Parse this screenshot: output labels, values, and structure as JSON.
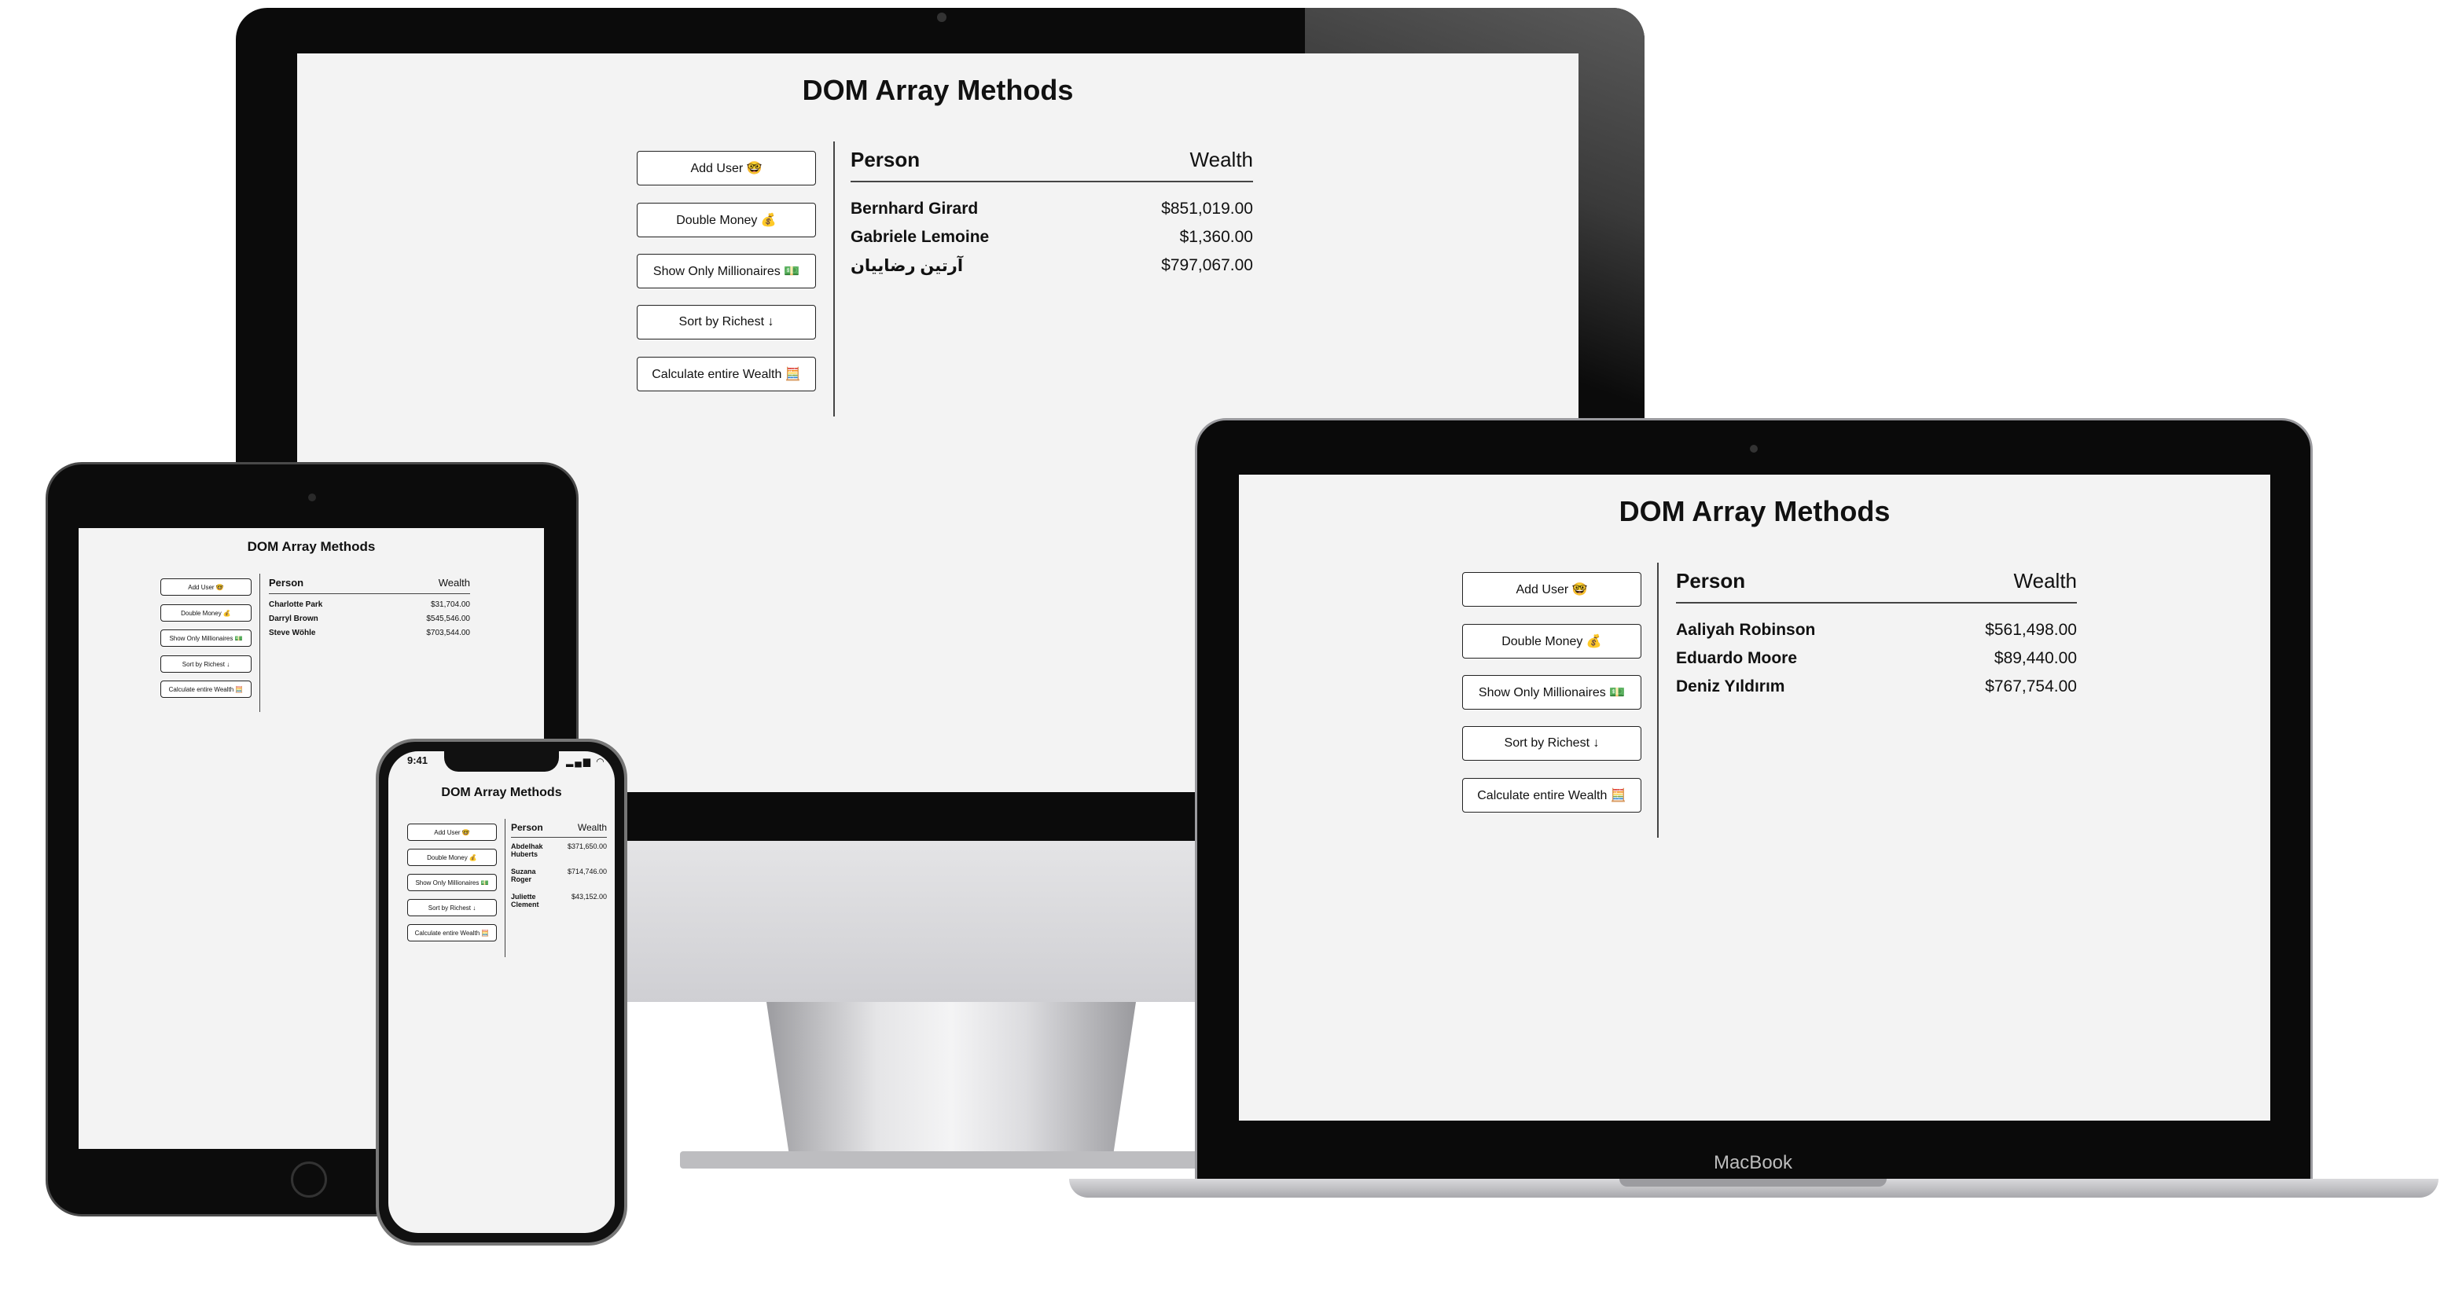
{
  "app": {
    "title": "DOM Array Methods",
    "buttons": {
      "add_user": "Add User 🤓",
      "double_money": "Double Money 💰",
      "show_millionaires": "Show Only Millionaires 💵",
      "sort_richest": "Sort by Richest ↓",
      "calculate_wealth": "Calculate entire Wealth 🧮"
    },
    "columns": {
      "person": "Person",
      "wealth": "Wealth"
    }
  },
  "devices": {
    "imac": {
      "rows": [
        {
          "person": "Bernhard Girard",
          "wealth": "$851,019.00"
        },
        {
          "person": "Gabriele Lemoine",
          "wealth": "$1,360.00"
        },
        {
          "person": "آرتین رضاییان",
          "wealth": "$797,067.00"
        }
      ]
    },
    "macbook": {
      "label": "MacBook",
      "rows": [
        {
          "person": "Aaliyah Robinson",
          "wealth": "$561,498.00"
        },
        {
          "person": "Eduardo Moore",
          "wealth": "$89,440.00"
        },
        {
          "person": "Deniz Yıldırım",
          "wealth": "$767,754.00"
        }
      ]
    },
    "ipad": {
      "rows": [
        {
          "person": "Charlotte Park",
          "wealth": "$31,704.00"
        },
        {
          "person": "Darryl Brown",
          "wealth": "$545,546.00"
        },
        {
          "person": "Steve Wöhle",
          "wealth": "$703,544.00"
        }
      ]
    },
    "iphone": {
      "status_time": "9:41",
      "status_icons": "▂▄▆ ◠ ▭",
      "rows": [
        {
          "person": "Abdelhak Huberts",
          "wealth": "$371,650.00"
        },
        {
          "person": "Suzana Roger",
          "wealth": "$714,746.00"
        },
        {
          "person": "Juliette Clement",
          "wealth": "$43,152.00"
        }
      ]
    }
  }
}
